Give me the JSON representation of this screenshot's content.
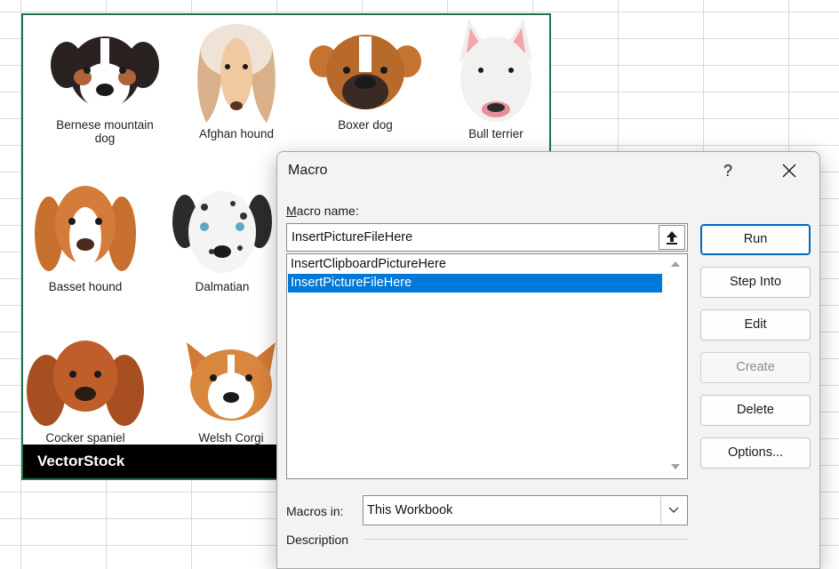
{
  "picture": {
    "dogs": [
      {
        "label": "Bernese mountain dog"
      },
      {
        "label": "Afghan hound"
      },
      {
        "label": "Boxer dog"
      },
      {
        "label": "Bull terrier"
      },
      {
        "label": "Basset hound"
      },
      {
        "label": "Dalmatian"
      },
      {
        "label": "Cocker spaniel"
      },
      {
        "label": "Welsh Corgi"
      }
    ],
    "watermark": "VectorStock"
  },
  "dialog": {
    "title": "Macro",
    "help": "?",
    "macro_name_label": "Macro name:",
    "macro_name_value": "InsertPictureFileHere",
    "macros": [
      {
        "name": "InsertClipboardPictureHere",
        "selected": false
      },
      {
        "name": "InsertPictureFileHere",
        "selected": true
      }
    ],
    "buttons": {
      "run": "Run",
      "step_into": "Step Into",
      "edit": "Edit",
      "create": "Create",
      "delete": "Delete",
      "options": "Options..."
    },
    "macros_in_label": "Macros in:",
    "macros_in_value": "This Workbook",
    "description_label": "Description"
  },
  "colors": {
    "selection": "#0078d7",
    "picture_border": "#217346",
    "default_button_border": "#0067c0"
  }
}
